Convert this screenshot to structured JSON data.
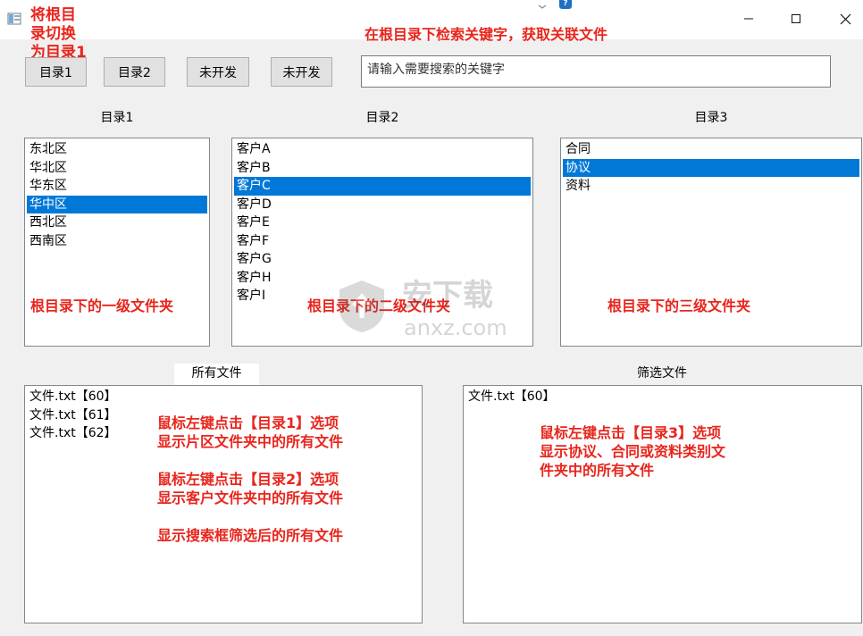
{
  "window": {
    "annotation_top_left": "将根目\n录切换\n为目录1",
    "annotation_top": "在根目录下检索关键字，获取关联文件",
    "help_badge": "?"
  },
  "toolbar": {
    "buttons": [
      "目录1",
      "目录2",
      "未开发",
      "未开发"
    ]
  },
  "search": {
    "placeholder": "请输入需要搜索的关键字"
  },
  "columns": {
    "dir1": {
      "header": "目录1",
      "items": [
        "东北区",
        "华北区",
        "华东区",
        "华中区",
        "西北区",
        "西南区"
      ],
      "selected": "华中区",
      "annotation": "根目录下的一级文件夹"
    },
    "dir2": {
      "header": "目录2",
      "items": [
        "客户A",
        "客户B",
        "客户C",
        "客户D",
        "客户E",
        "客户F",
        "客户G",
        "客户H",
        "客户I"
      ],
      "selected": "客户C",
      "annotation": "根目录下的二级文件夹"
    },
    "dir3": {
      "header": "目录3",
      "items": [
        "合同",
        "协议",
        "资料"
      ],
      "selected": "协议",
      "annotation": "根目录下的三级文件夹"
    }
  },
  "all_files": {
    "header": "所有文件",
    "items": [
      "文件.txt【60】",
      "文件.txt【61】",
      "文件.txt【62】"
    ],
    "annotation": "鼠标左键点击【目录1】选项\n显示片区文件夹中的所有文件\n\n鼠标左键点击【目录2】选项\n显示客户文件夹中的所有文件\n\n显示搜索框筛选后的所有文件"
  },
  "filtered_files": {
    "header": "筛选文件",
    "items": [
      "文件.txt【60】"
    ],
    "annotation": "鼠标左键点击【目录3】选项\n显示协议、合同或资料类别文\n件夹中的所有文件"
  },
  "watermark": {
    "text_cn": "安下载",
    "text_en": "anxz.com"
  },
  "colors": {
    "annotation": "#e8251c",
    "selection": "#0078d7",
    "help_badge": "#1f6fc5"
  }
}
